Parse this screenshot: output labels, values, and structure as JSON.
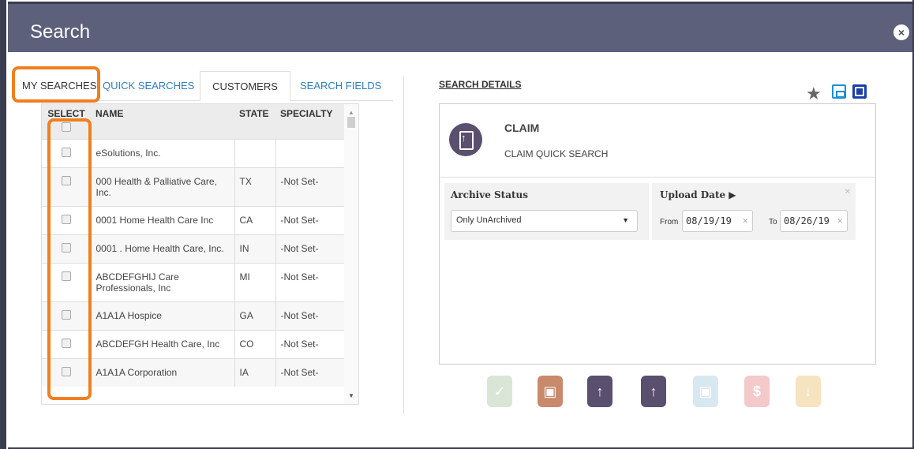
{
  "window": {
    "title": "Search",
    "close_glyph": "×"
  },
  "tabs": [
    {
      "label": "MY SEARCHES"
    },
    {
      "label": "QUICK SEARCHES"
    },
    {
      "label": "CUSTOMERS"
    },
    {
      "label": "SEARCH FIELDS"
    }
  ],
  "table": {
    "headers": {
      "select": "SELECT",
      "name": "NAME",
      "state": "STATE",
      "specialty": "SPECIALTY"
    },
    "rows": [
      {
        "name": "eSolutions, Inc.",
        "state": "",
        "specialty": ""
      },
      {
        "name": "000 Health & Palliative Care, Inc.",
        "state": "TX",
        "specialty": "-Not Set-"
      },
      {
        "name": "0001    Home Health Care Inc",
        "state": "CA",
        "specialty": "-Not Set-"
      },
      {
        "name": "0001   . Home Health Care, Inc.",
        "state": "IN",
        "specialty": "-Not Set-"
      },
      {
        "name": "ABCDEFGHIJ Care Professionals, Inc",
        "state": "MI",
        "specialty": "-Not Set-"
      },
      {
        "name": "A1A1A Hospice",
        "state": "GA",
        "specialty": "-Not Set-"
      },
      {
        "name": "ABCDEFGH  Health Care, Inc",
        "state": "CO",
        "specialty": "-Not Set-"
      },
      {
        "name": "A1A1A  Corporation",
        "state": "IA",
        "specialty": "-Not Set-"
      }
    ]
  },
  "details": {
    "title": "SEARCH DETAILS",
    "claim_title": "CLAIM",
    "claim_subtitle": "CLAIM QUICK SEARCH",
    "archive_label": "Archive Status",
    "archive_value": "Only UnArchived",
    "upload_label": "Upload Date ▶",
    "from_label": "From",
    "from_value": "08/19/19",
    "to_label": "To",
    "to_value": "08/26/19"
  },
  "icons": {
    "favorite": "star-icon",
    "save": "save-icon",
    "save_as": "save-as-icon"
  },
  "colors": {
    "header_bg": "#5c607a",
    "highlight": "#f07f1f",
    "link": "#2d7dc3",
    "claim_purple": "#5a4f6e"
  }
}
